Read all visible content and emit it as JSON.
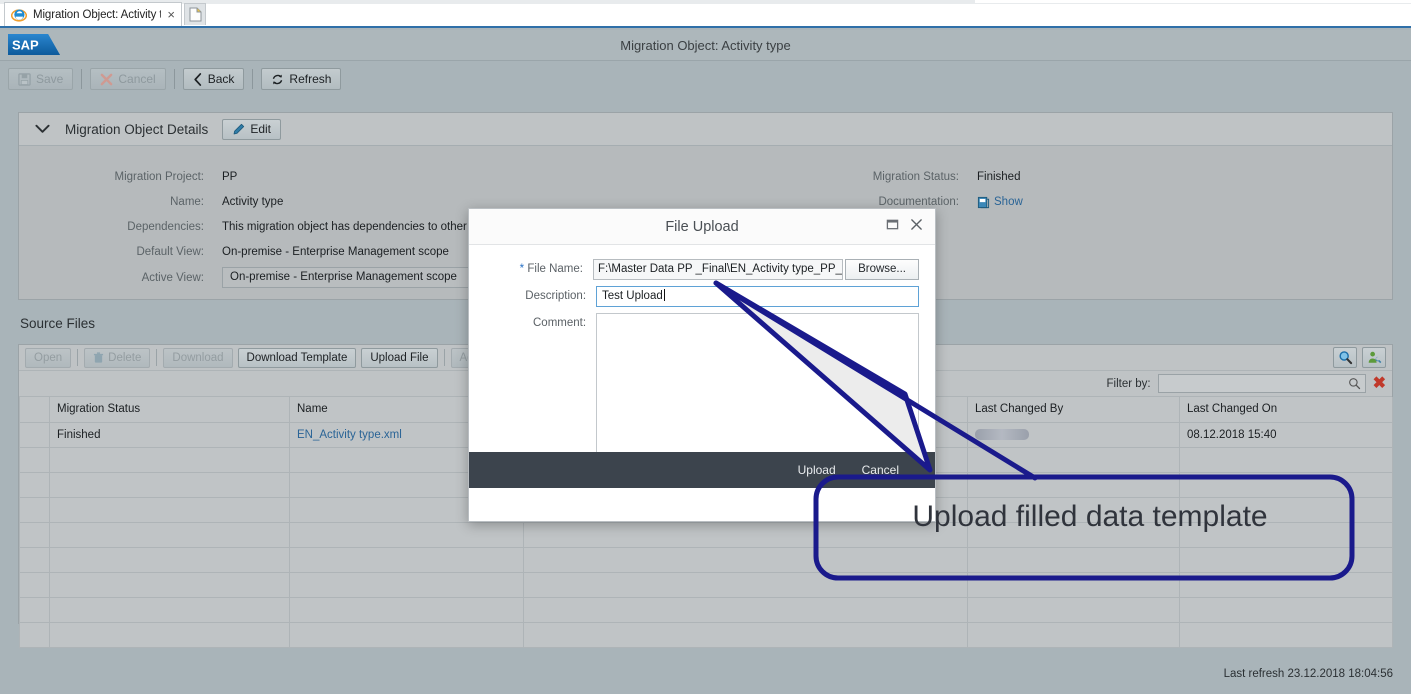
{
  "browser": {
    "tab_title": "Migration Object: Activity t...",
    "tab_close": "×",
    "favicon": "ie-icon",
    "newtab": "new-tab-icon"
  },
  "shell": {
    "logo": "sap-logo",
    "title": "Migration Object: Activity type"
  },
  "toolbar": {
    "save": "Save",
    "cancel": "Cancel",
    "back": "Back",
    "refresh": "Refresh"
  },
  "details": {
    "panel_title": "Migration Object Details",
    "edit": "Edit",
    "fields_left": [
      {
        "label": "Migration Project:",
        "value": "PP"
      },
      {
        "label": "Name:",
        "value": "Activity type"
      },
      {
        "label": "Dependencies:",
        "value": "This migration object has dependencies to other objects"
      },
      {
        "label": "Default View:",
        "value": "On-premise - Enterprise Management scope"
      },
      {
        "label": "Active View:",
        "value": "On-premise - Enterprise Management scope"
      }
    ],
    "fields_right": [
      {
        "label": "Migration Status:",
        "value": "Finished"
      },
      {
        "label": "Documentation:",
        "value": "Show"
      }
    ],
    "doc_icon": "document-icon"
  },
  "source_files": {
    "section_title": "Source Files",
    "buttons": [
      {
        "label": "Open",
        "enabled": false
      },
      {
        "label": "Delete",
        "enabled": false,
        "icon": "trash-icon"
      },
      {
        "label": "Download",
        "enabled": false
      },
      {
        "label": "Download Template",
        "enabled": true
      },
      {
        "label": "Upload File",
        "enabled": true
      },
      {
        "label": "Activate",
        "enabled": false
      }
    ],
    "right_icons": [
      {
        "name": "search-icon"
      },
      {
        "name": "personalize-icon"
      }
    ],
    "filter_label": "Filter by:",
    "filter_value": "",
    "filter_clear": "✖",
    "columns": [
      "Migration Status",
      "Name",
      "Last Changed By",
      "Last Changed On"
    ],
    "rows": [
      {
        "migration_status": "Finished",
        "name": "EN_Activity type.xml",
        "last_changed_by": "",
        "last_changed_by_redacted": true,
        "last_changed_on": "08.12.2018 15:40"
      }
    ],
    "empty_row_count": 8
  },
  "dialog": {
    "title": "File Upload",
    "restore_icon": "restore-window-icon",
    "close_icon": "close-icon",
    "file_name_label": "File Name:",
    "file_name_required": "*",
    "file_name_value": "F:\\Master Data PP _Final\\EN_Activity type_PP_Ma",
    "browse_label": "Browse...",
    "description_label": "Description:",
    "description_value": "Test Upload",
    "comment_label": "Comment:",
    "comment_value": "",
    "upload_label": "Upload",
    "cancel_label": "Cancel"
  },
  "annotation": {
    "callout_text": "Upload filled data template",
    "color": "#1a1a8c"
  },
  "status": {
    "last_refresh": "Last refresh 23.12.2018 18:04:56"
  },
  "colors": {
    "shell_bg": "#adb7bb",
    "app_bg": "#a9b4b9",
    "panel_bg": "#b6babc",
    "table_bg": "#c0c4c6",
    "dialog_footer": "#3c444d",
    "link": "#2a6496",
    "annotation": "#1a1a8c"
  }
}
